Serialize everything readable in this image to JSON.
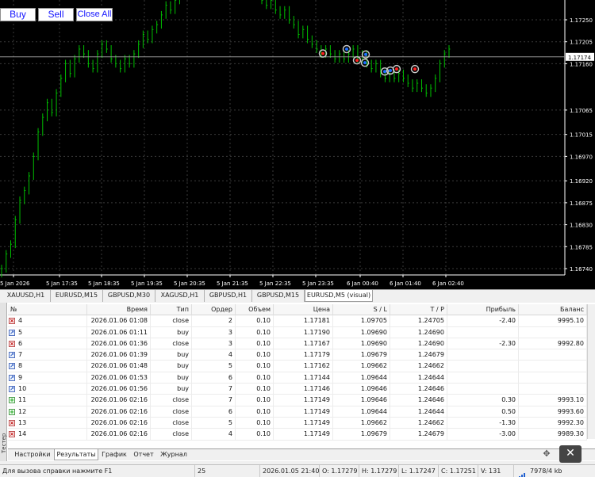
{
  "toolbar": {
    "buy_label": "Buy",
    "sell_label": "Sell",
    "close_all_label": "Close All"
  },
  "colors": {
    "candle_up": "#00c000",
    "background": "#000000",
    "grid": "#3a3a3a",
    "axis_text": "#ffffff",
    "bid_line": "#9a9a9a",
    "trade_marker_ring": "#c8c8c8",
    "trade_marker_buy": "#1e6fff",
    "trade_marker_sell": "#ff2020"
  },
  "chart_data": {
    "type": "candlestick",
    "symbol": "EURUSD",
    "timeframe": "M5",
    "y_axis": {
      "ticks": [
        "1.17250",
        "1.17205",
        "1.17160",
        "1.17065",
        "1.17015",
        "1.16970",
        "1.16920",
        "1.16875",
        "1.16830",
        "1.16785",
        "1.16740"
      ],
      "tick_values": [
        1.1725,
        1.17205,
        1.1716,
        1.17065,
        1.17015,
        1.1697,
        1.1692,
        1.16875,
        1.1683,
        1.16785,
        1.1674
      ],
      "current_price_label": "1.17174",
      "current_price": 1.17174
    },
    "x_axis": {
      "ticks": [
        "5 Jan 2026",
        "5 Jan 17:35",
        "5 Jan 18:35",
        "5 Jan 19:35",
        "5 Jan 20:35",
        "5 Jan 21:35",
        "5 Jan 22:35",
        "5 Jan 23:35",
        "6 Jan 00:40",
        "6 Jan 01:40",
        "6 Jan 02:40"
      ]
    },
    "grid": true,
    "closes": [
      1.1674,
      1.1677,
      1.1679,
      1.1684,
      1.1688,
      1.169,
      1.1693,
      1.1697,
      1.1702,
      1.1705,
      1.1708,
      1.1706,
      1.171,
      1.1713,
      1.1716,
      1.1714,
      1.1717,
      1.1719,
      1.1718,
      1.1716,
      1.1715,
      1.1718,
      1.172,
      1.1719,
      1.1717,
      1.1716,
      1.1715,
      1.1717,
      1.1716,
      1.1718,
      1.172,
      1.1722,
      1.1721,
      1.1723,
      1.1724,
      1.1726,
      1.1728,
      1.1727,
      1.1729,
      1.173,
      1.1731,
      1.1732,
      1.1733,
      1.1732,
      1.1733,
      1.1734,
      1.1735,
      1.1734,
      1.1735,
      1.1734,
      1.1733,
      1.1734,
      1.1733,
      1.1732,
      1.1731,
      1.173,
      1.1731,
      1.1729,
      1.1728,
      1.1729,
      1.1727,
      1.1726,
      1.1727,
      1.1725,
      1.1724,
      1.1722,
      1.1723,
      1.1721,
      1.172,
      1.1719,
      1.1718,
      1.1719,
      1.1718,
      1.1717,
      1.1718,
      1.1717,
      1.1718,
      1.1719,
      1.1717,
      1.1718,
      1.1716,
      1.1715,
      1.1716,
      1.1714,
      1.1713,
      1.1714,
      1.1713,
      1.1714,
      1.1713,
      1.1712,
      1.1711,
      1.1712,
      1.1711,
      1.171,
      1.1711,
      1.1713,
      1.1716,
      1.1718,
      1.1719
    ],
    "trade_markers": [
      {
        "price": 1.17181,
        "type": "close"
      },
      {
        "price": 1.1719,
        "type": "buy"
      },
      {
        "price": 1.17167,
        "type": "close"
      },
      {
        "price": 1.17179,
        "type": "buy"
      },
      {
        "price": 1.17162,
        "type": "buy"
      },
      {
        "price": 1.17144,
        "type": "buy"
      },
      {
        "price": 1.17146,
        "type": "buy"
      },
      {
        "price": 1.17149,
        "type": "close"
      },
      {
        "price": 1.17149,
        "type": "close"
      }
    ]
  },
  "symbol_tabs": [
    "XAUUSD,H1",
    "EURUSD,M15",
    "GBPUSD,M30",
    "XAGUSD,H1",
    "GBPUSD,H1",
    "GBPUSD,M15",
    "EURUSD,M5 (visual)"
  ],
  "table": {
    "columns": [
      "№",
      "Время",
      "Тип",
      "Ордер",
      "Объем",
      "Цена",
      "S / L",
      "T / P",
      "Прибыль",
      "Баланс"
    ],
    "rows": [
      {
        "n": "4",
        "time": "2026.01.06 01:08",
        "type": "close",
        "order": "2",
        "volume": "0.10",
        "price": "1.17181",
        "sl": "1.09705",
        "tp": "1.24705",
        "profit": "-2.40",
        "balance": "9995.10",
        "icon": "close-icon"
      },
      {
        "n": "5",
        "time": "2026.01.06 01:11",
        "type": "buy",
        "order": "3",
        "volume": "0.10",
        "price": "1.17190",
        "sl": "1.09690",
        "tp": "1.24690",
        "profit": "",
        "balance": "",
        "icon": "buy-icon"
      },
      {
        "n": "6",
        "time": "2026.01.06 01:36",
        "type": "close",
        "order": "3",
        "volume": "0.10",
        "price": "1.17167",
        "sl": "1.09690",
        "tp": "1.24690",
        "profit": "-2.30",
        "balance": "9992.80",
        "icon": "close-icon"
      },
      {
        "n": "7",
        "time": "2026.01.06 01:39",
        "type": "buy",
        "order": "4",
        "volume": "0.10",
        "price": "1.17179",
        "sl": "1.09679",
        "tp": "1.24679",
        "profit": "",
        "balance": "",
        "icon": "buy-icon"
      },
      {
        "n": "8",
        "time": "2026.01.06 01:48",
        "type": "buy",
        "order": "5",
        "volume": "0.10",
        "price": "1.17162",
        "sl": "1.09662",
        "tp": "1.24662",
        "profit": "",
        "balance": "",
        "icon": "buy-icon"
      },
      {
        "n": "9",
        "time": "2026.01.06 01:53",
        "type": "buy",
        "order": "6",
        "volume": "0.10",
        "price": "1.17144",
        "sl": "1.09644",
        "tp": "1.24644",
        "profit": "",
        "balance": "",
        "icon": "buy-icon"
      },
      {
        "n": "10",
        "time": "2026.01.06 01:56",
        "type": "buy",
        "order": "7",
        "volume": "0.10",
        "price": "1.17146",
        "sl": "1.09646",
        "tp": "1.24646",
        "profit": "",
        "balance": "",
        "icon": "buy-icon"
      },
      {
        "n": "11",
        "time": "2026.01.06 02:16",
        "type": "close",
        "order": "7",
        "volume": "0.10",
        "price": "1.17149",
        "sl": "1.09646",
        "tp": "1.24646",
        "profit": "0.30",
        "balance": "9993.10",
        "icon": "close-icon"
      },
      {
        "n": "12",
        "time": "2026.01.06 02:16",
        "type": "close",
        "order": "6",
        "volume": "0.10",
        "price": "1.17149",
        "sl": "1.09644",
        "tp": "1.24644",
        "profit": "0.50",
        "balance": "9993.60",
        "icon": "close-icon"
      },
      {
        "n": "13",
        "time": "2026.01.06 02:16",
        "type": "close",
        "order": "5",
        "volume": "0.10",
        "price": "1.17149",
        "sl": "1.09662",
        "tp": "1.24662",
        "profit": "-1.30",
        "balance": "9992.30",
        "icon": "close-icon"
      },
      {
        "n": "14",
        "time": "2026.01.06 02:16",
        "type": "close",
        "order": "4",
        "volume": "0.10",
        "price": "1.17149",
        "sl": "1.09679",
        "tp": "1.24679",
        "profit": "-3.00",
        "balance": "9989.30",
        "icon": "close-icon"
      }
    ]
  },
  "sidebar_label": "Тестер",
  "bottom_tabs": [
    "Настройки",
    "Результаты",
    "График",
    "Отчет",
    "Журнал"
  ],
  "active_bottom_tab": "Результаты",
  "status_bar": {
    "help": "Для вызова справки нажмите F1",
    "count": "25",
    "datetime": "2026.01.05 21:40",
    "open": "O: 1.17279",
    "high": "H: 1.17279",
    "low": "L: 1.17247",
    "close": "C: 1.17251",
    "volume": "V: 131",
    "traffic": "7978/4 kb"
  }
}
